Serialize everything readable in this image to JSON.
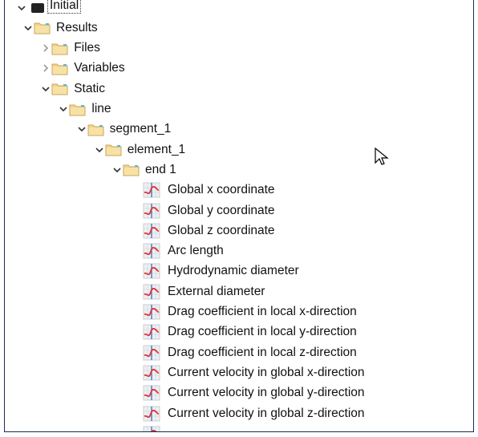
{
  "tree": {
    "root": {
      "label": "Initial",
      "expanded": true
    },
    "nodes": [
      {
        "label": "Results",
        "level": 1,
        "type": "folder",
        "expanded": true
      },
      {
        "label": "Files",
        "level": 2,
        "type": "folder",
        "expanded": false
      },
      {
        "label": "Variables",
        "level": 2,
        "type": "folder",
        "expanded": false
      },
      {
        "label": "Static",
        "level": 2,
        "type": "folder",
        "expanded": true
      },
      {
        "label": "line",
        "level": 3,
        "type": "folder",
        "expanded": true
      },
      {
        "label": "segment_1",
        "level": 4,
        "type": "folder",
        "expanded": true
      },
      {
        "label": "element_1",
        "level": 5,
        "type": "folder",
        "expanded": true
      },
      {
        "label": "end 1",
        "level": 6,
        "type": "folder",
        "expanded": true
      },
      {
        "label": "Global x coordinate",
        "level": 7,
        "type": "variable"
      },
      {
        "label": "Global y coordinate",
        "level": 7,
        "type": "variable"
      },
      {
        "label": "Global z coordinate",
        "level": 7,
        "type": "variable"
      },
      {
        "label": "Arc length",
        "level": 7,
        "type": "variable"
      },
      {
        "label": "Hydrodynamic diameter",
        "level": 7,
        "type": "variable"
      },
      {
        "label": "External diameter",
        "level": 7,
        "type": "variable"
      },
      {
        "label": "Drag coefficient in local x-direction",
        "level": 7,
        "type": "variable"
      },
      {
        "label": "Drag coefficient in local y-direction",
        "level": 7,
        "type": "variable"
      },
      {
        "label": "Drag coefficient in local z-direction",
        "level": 7,
        "type": "variable"
      },
      {
        "label": "Current velocity in global x-direction",
        "level": 7,
        "type": "variable"
      },
      {
        "label": "Current velocity in global y-direction",
        "level": 7,
        "type": "variable"
      },
      {
        "label": "Current velocity in global z-direction",
        "level": 7,
        "type": "variable"
      },
      {
        "label": "",
        "level": 7,
        "type": "variable"
      }
    ]
  },
  "colors": {
    "border": "#1c2d4a",
    "folder": "#f0d58c",
    "curve": "#e0343a"
  }
}
